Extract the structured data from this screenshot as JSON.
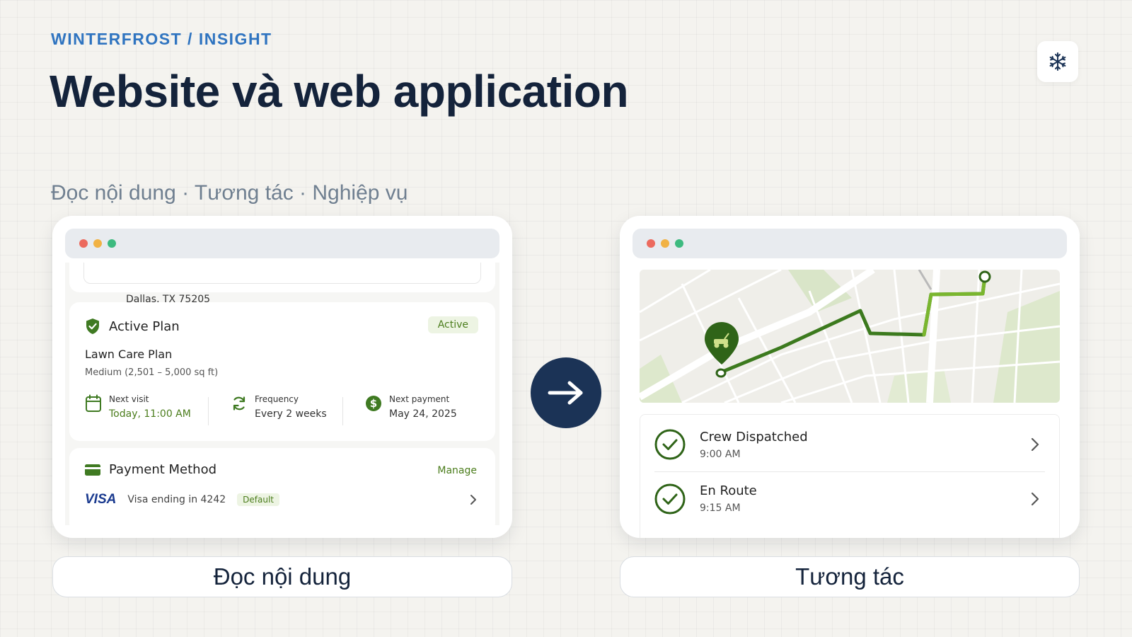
{
  "header": {
    "brand": "WINTERFROST / INSIGHT",
    "title": "Website và web application",
    "subtitle": "Đọc nội dung · Tương tác · Nghiệp vụ",
    "logo_icon": "snowflake-icon"
  },
  "left_window": {
    "address_fragment": "Dallas, TX 75205",
    "plan": {
      "title": "Active Plan",
      "status": "Active",
      "name": "Lawn Care Plan",
      "size": "Medium (2,501 – 5,000 sq ft)",
      "stats": [
        {
          "label": "Next visit",
          "value": "Today, 11:00 AM",
          "icon": "calendar-icon"
        },
        {
          "label": "Frequency",
          "value": "Every 2 weeks",
          "icon": "refresh-icon"
        },
        {
          "label": "Next payment",
          "value": "May 24, 2025",
          "icon": "dollar-icon"
        }
      ]
    },
    "payment": {
      "title": "Payment Method",
      "manage": "Manage",
      "card_brand": "VISA",
      "card_text": "Visa ending in 4242",
      "default_badge": "Default"
    }
  },
  "transition": {
    "icon": "arrow-right-icon"
  },
  "right_window": {
    "timeline": [
      {
        "title": "Crew Dispatched",
        "time": "9:00 AM",
        "icon": "check-circle-icon"
      },
      {
        "title": "En Route",
        "time": "9:15 AM",
        "icon": "check-circle-icon"
      }
    ]
  },
  "captions": {
    "left": "Đọc nội dung",
    "right": "Tương tác"
  },
  "colors": {
    "brand_blue": "#2f74c0",
    "navy": "#14233b",
    "accent_green": "#4b7d1c",
    "arrow_bg": "#1b3356"
  }
}
